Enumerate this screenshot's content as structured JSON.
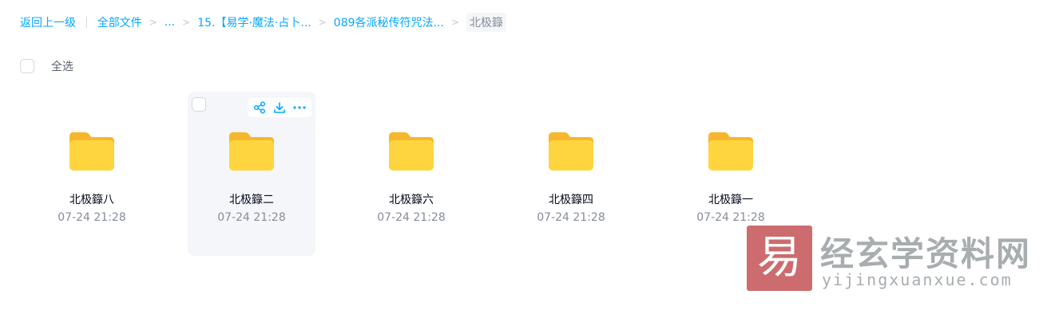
{
  "breadcrumb": {
    "back": "返回上一级",
    "root": "全部文件",
    "ellipsis": "...",
    "level1": "15.【易学·魔法·占卜...",
    "level2": "089各派秘传符咒法...",
    "current": "北极籙",
    "separator": ">"
  },
  "toolbar": {
    "select_all_label": "全选"
  },
  "files": [
    {
      "name": "北极籙八",
      "time": "07-24 21:28"
    },
    {
      "name": "北极籙二",
      "time": "07-24 21:28"
    },
    {
      "name": "北极籙六",
      "time": "07-24 21:28"
    },
    {
      "name": "北极籙四",
      "time": "07-24 21:28"
    },
    {
      "name": "北极籙一",
      "time": "07-24 21:28"
    }
  ],
  "hovered_card_actions": [
    "share-icon",
    "download-icon",
    "more-icon"
  ],
  "watermark": {
    "logo_char": "易",
    "title": "经玄学资料网",
    "url": "yijingxuanxue.com"
  },
  "colors": {
    "accent": "#06a7ff",
    "text_primary": "#03081a",
    "text_secondary": "#878c9c",
    "folder_yellow": "#ffd53f",
    "hover_bg": "#f5f6f9",
    "watermark_red": "#c6585c"
  }
}
